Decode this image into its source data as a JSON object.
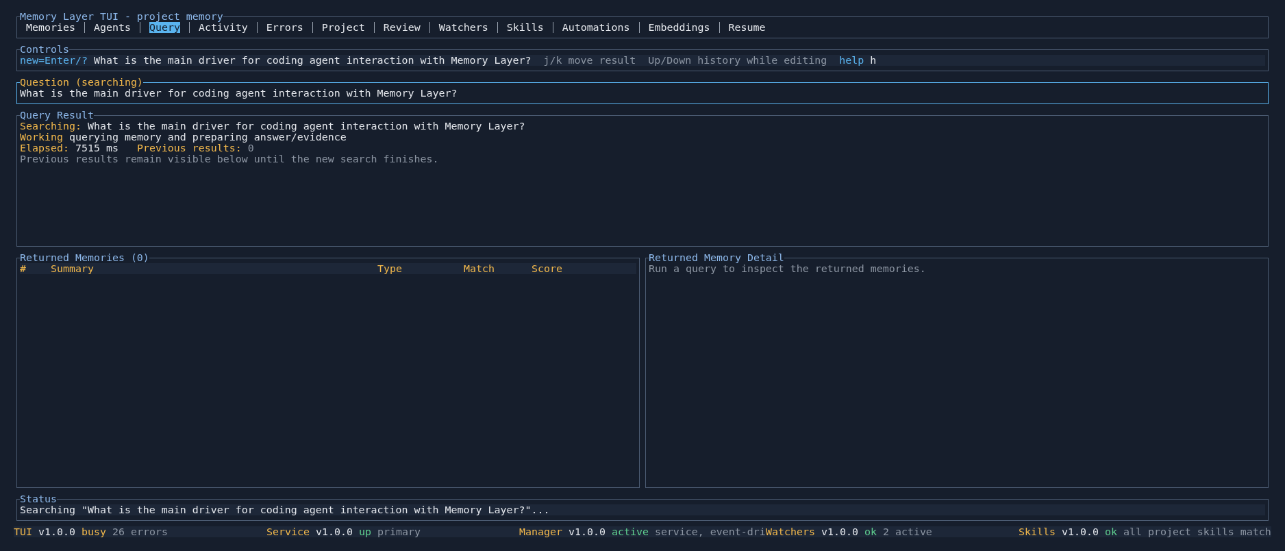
{
  "window": {
    "title": "Memory Layer TUI - project memory"
  },
  "tabs": [
    {
      "label": "Memories",
      "selected": false
    },
    {
      "label": "Agents",
      "selected": false
    },
    {
      "label": "Query",
      "selected": true
    },
    {
      "label": "Activity",
      "selected": false
    },
    {
      "label": "Errors",
      "selected": false
    },
    {
      "label": "Project",
      "selected": false
    },
    {
      "label": "Review",
      "selected": false
    },
    {
      "label": "Watchers",
      "selected": false
    },
    {
      "label": "Skills",
      "selected": false
    },
    {
      "label": "Automations",
      "selected": false
    },
    {
      "label": "Embeddings",
      "selected": false
    },
    {
      "label": "Resume",
      "selected": false
    }
  ],
  "controls": {
    "title": "Controls",
    "segments": [
      {
        "kind": "key",
        "text": "new=Enter/?"
      },
      {
        "kind": "input",
        "text": "What is the main driver for coding agent interaction with Memory Layer?"
      },
      {
        "kind": "hint",
        "text": "j/k move result"
      },
      {
        "kind": "hint",
        "text": "Up/Down history while editing"
      },
      {
        "kind": "key",
        "text": "help"
      },
      {
        "kind": "input",
        "text": "h"
      }
    ]
  },
  "question": {
    "title": "Question (searching)",
    "focused": true,
    "value": "What is the main driver for coding agent interaction with Memory Layer?"
  },
  "query_result": {
    "title": "Query Result",
    "lines": [
      {
        "segments": [
          {
            "kind": "label",
            "text": "Searching:"
          },
          {
            "kind": "value",
            "text": "What is the main driver for coding agent interaction with Memory Layer?"
          }
        ]
      },
      {
        "segments": [
          {
            "kind": "label",
            "text": "Working"
          },
          {
            "kind": "value",
            "text": "querying memory and preparing answer/evidence"
          }
        ]
      },
      {
        "segments": [
          {
            "kind": "label",
            "text": "Elapsed:"
          },
          {
            "kind": "value",
            "text": "7515 ms"
          },
          {
            "kind": "label",
            "text": "Previous results:"
          },
          {
            "kind": "muted",
            "text": "0"
          }
        ]
      },
      {
        "segments": [
          {
            "kind": "muted",
            "text": "Previous results remain visible below until the new search finishes."
          }
        ]
      }
    ]
  },
  "returned_memories": {
    "title": "Returned Memories (0)",
    "columns": [
      "#",
      "Summary",
      "Type",
      "Match",
      "Score"
    ]
  },
  "memory_detail": {
    "title": "Returned Memory Detail",
    "text": "Run a query to inspect the returned memories."
  },
  "status": {
    "title": "Status",
    "message": "Searching \"What is the main driver for coding agent interaction with Memory Layer?\"..."
  },
  "status_bar": [
    {
      "name": "TUI",
      "version": "v1.0.0",
      "state": "busy",
      "color": "#f2b84b",
      "detail": "26 errors"
    },
    {
      "name": "Service",
      "version": "v1.0.0",
      "state": "up",
      "color": "#5fcf8f",
      "detail": "primary"
    },
    {
      "name": "Manager",
      "version": "v1.0.0",
      "state": "active",
      "color": "#5fcf8f",
      "detail": "service, event-dri"
    },
    {
      "name": "Watchers",
      "version": "v1.0.0",
      "state": "ok",
      "color": "#5fcf8f",
      "detail": "2 active"
    },
    {
      "name": "Skills",
      "version": "v1.0.0",
      "state": "ok",
      "color": "#5fcf8f",
      "detail": "all project skills match"
    }
  ]
}
